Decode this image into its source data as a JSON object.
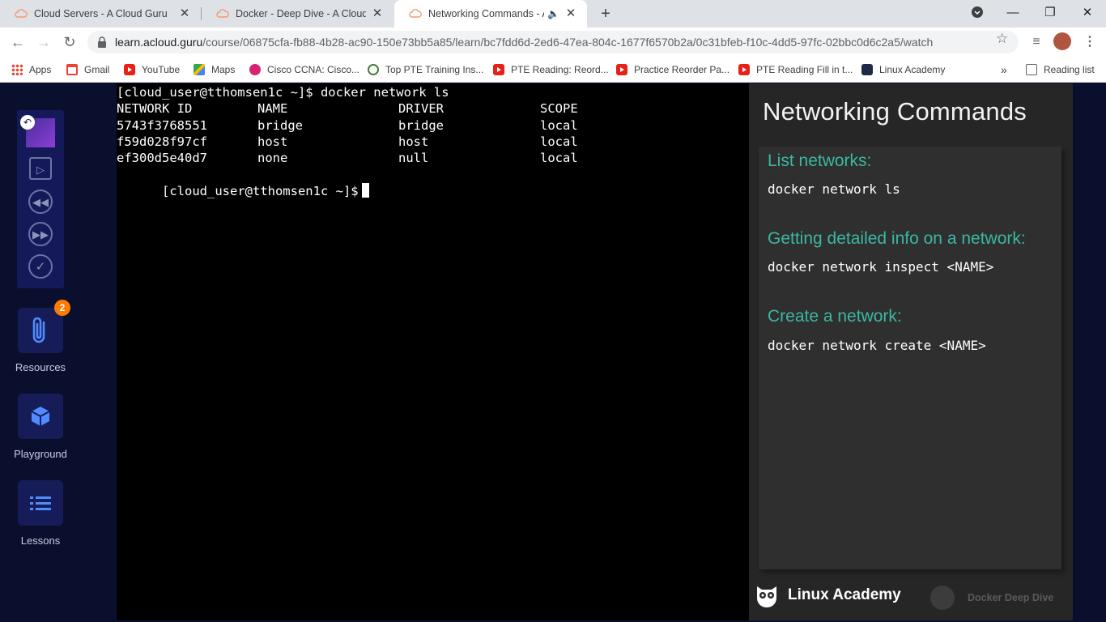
{
  "browser": {
    "tabs": [
      {
        "title": "Cloud Servers - A Cloud Guru",
        "active": false
      },
      {
        "title": "Docker - Deep Dive - A Cloud Guru",
        "active": false
      },
      {
        "title": "Networking Commands - A Cloud Guru",
        "active": true
      }
    ],
    "url_host": "learn.acloud.guru",
    "url_path": "/course/06875cfa-fb88-4b28-ac90-150e73bb5a85/learn/bc7fdd6d-2ed6-47ea-804c-1677f6570b2a/0c31bfeb-f10c-4dd5-97fc-02bbc0d6c2a5/watch",
    "bookmarks": [
      {
        "label": "Apps",
        "icon": "apps-grid-icon"
      },
      {
        "label": "Gmail",
        "icon": "gmail-icon"
      },
      {
        "label": "YouTube",
        "icon": "youtube-icon"
      },
      {
        "label": "Maps",
        "icon": "maps-icon"
      },
      {
        "label": "Cisco CCNA: Cisco...",
        "icon": "cisco-icon"
      },
      {
        "label": "Top PTE Training Ins...",
        "icon": "pte-training-icon"
      },
      {
        "label": "PTE Reading: Reord...",
        "icon": "youtube-icon"
      },
      {
        "label": "Practice Reorder Pa...",
        "icon": "youtube-icon"
      },
      {
        "label": "PTE Reading Fill in t...",
        "icon": "youtube-icon"
      },
      {
        "label": "Linux Academy",
        "icon": "linux-academy-icon"
      }
    ],
    "more_bookmarks": "»",
    "reading_list": "Reading list"
  },
  "sidebar": {
    "resources_label": "Resources",
    "resources_badge": "2",
    "playground_label": "Playground",
    "lessons_label": "Lessons"
  },
  "terminal": {
    "command_line": "[cloud_user@tthomsen1c ~]$ docker network ls",
    "headers": [
      "NETWORK ID",
      "NAME",
      "DRIVER",
      "SCOPE"
    ],
    "rows": [
      [
        "5743f3768551",
        "bridge",
        "bridge",
        "local"
      ],
      [
        "f59d028f97cf",
        "host",
        "host",
        "local"
      ],
      [
        "ef300d5e40d7",
        "none",
        "null",
        "local"
      ]
    ],
    "prompt": "[cloud_user@tthomsen1c ~]$"
  },
  "slide": {
    "title": "Networking Commands",
    "sections": [
      {
        "heading": "List networks:",
        "command": "docker network ls"
      },
      {
        "heading": "Getting detailed info on a network:",
        "command": "docker network inspect <NAME>"
      },
      {
        "heading": "Create a network:",
        "command": "docker network create <NAME>"
      }
    ],
    "brand": "Linux Academy",
    "course": "Docker Deep Dive"
  },
  "colors": {
    "accent_teal": "#3ab8a2",
    "sidebar_bg": "#0b0f2e",
    "badge_orange": "#ff7a00"
  }
}
